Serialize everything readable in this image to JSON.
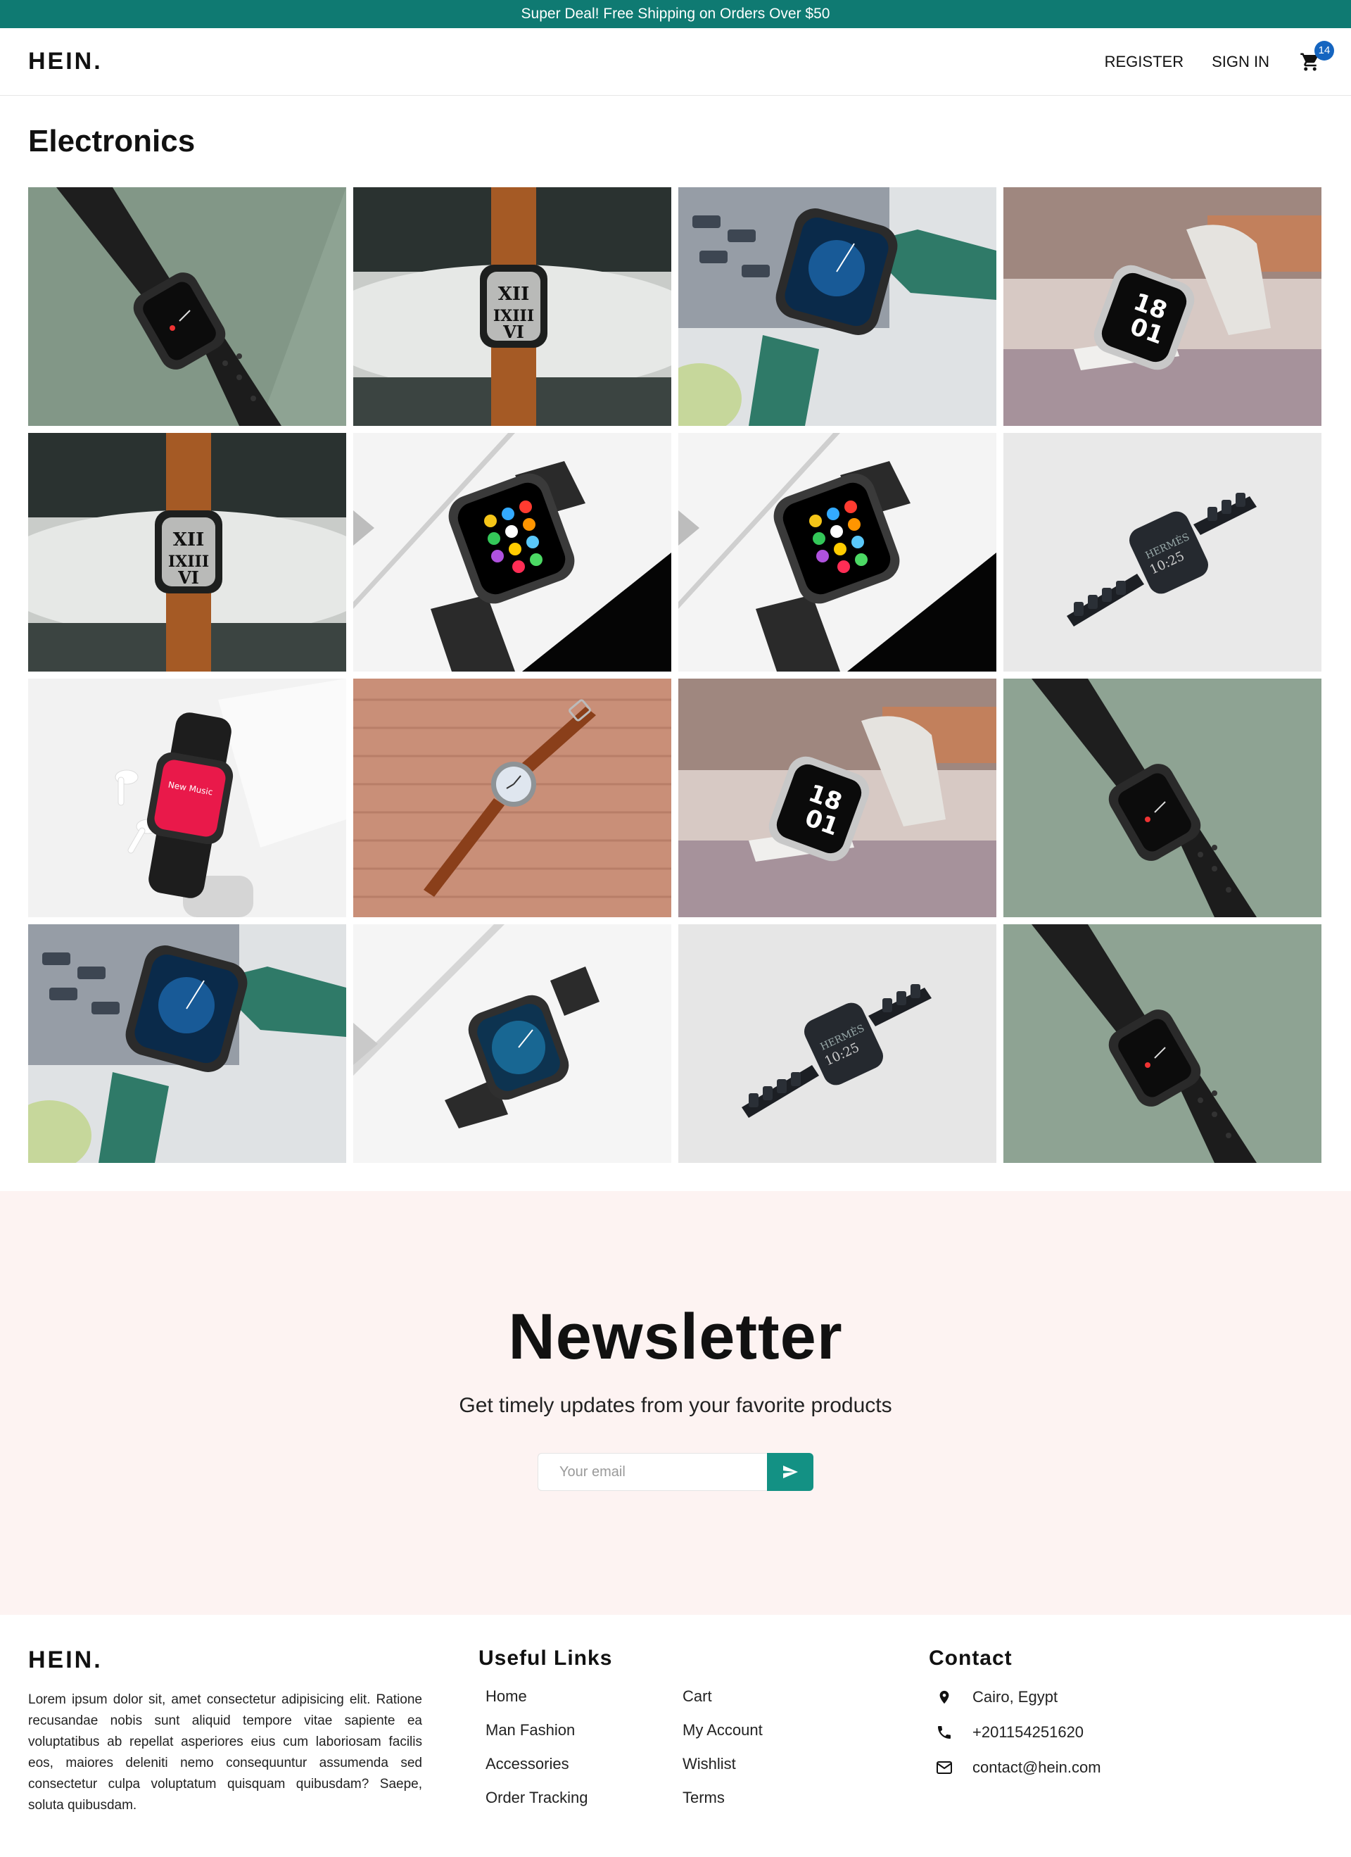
{
  "announcement": "Super Deal! Free Shipping on Orders Over $50",
  "header": {
    "logo": "HEIN.",
    "register_label": "REGISTER",
    "signin_label": "SIGN IN",
    "cart_count": "14",
    "cart_icon": "cart-icon"
  },
  "category": {
    "title": "Electronics"
  },
  "products": [
    {
      "image": "smartwatch-black-sport-band"
    },
    {
      "image": "smartwatch-orange-band-roman-dial"
    },
    {
      "image": "smartwatch-green-leather-band"
    },
    {
      "image": "smartwatch-white-band-nike-dial"
    },
    {
      "image": "smartwatch-orange-band-roman-dial"
    },
    {
      "image": "smartwatch-apps-grid-black-band"
    },
    {
      "image": "smartwatch-apps-grid-black-band"
    },
    {
      "image": "smartwatch-black-link-bracelet"
    },
    {
      "image": "smartwatch-music-with-airpods"
    },
    {
      "image": "smartwatch-brown-leather-on-wood"
    },
    {
      "image": "smartwatch-white-band-nike-dial"
    },
    {
      "image": "smartwatch-black-sport-band"
    },
    {
      "image": "smartwatch-green-leather-band"
    },
    {
      "image": "smartwatch-blue-dial-black-band"
    },
    {
      "image": "smartwatch-black-link-bracelet"
    },
    {
      "image": "smartwatch-black-sport-band"
    }
  ],
  "newsletter": {
    "title": "Newsletter",
    "subtitle": "Get timely updates from your favorite products",
    "email_placeholder": "Your email",
    "submit_icon": "send-icon"
  },
  "footer": {
    "logo": "HEIN.",
    "about": "Lorem ipsum dolor sit, amet consectetur adipisicing elit. Ratione recusandae nobis sunt aliquid tempore vitae sapiente ea voluptatibus ab repellat asperiores eius cum laboriosam facilis eos, maiores deleniti nemo consequuntur assumenda sed consectetur culpa voluptatum quisquam quibusdam? Saepe, soluta quibusdam.",
    "links_heading": "Useful Links",
    "links": [
      "Home",
      "Cart",
      "Man Fashion",
      "My Account",
      "Accessories",
      "Wishlist",
      "Order Tracking",
      "Terms"
    ],
    "contact_heading": "Contact",
    "contact": {
      "address": "Cairo, Egypt",
      "phone": "+201154251620",
      "email": "contact@hein.com"
    }
  },
  "colors": {
    "accent": "#0f7a72",
    "button": "#139184",
    "badge": "#1565c0",
    "newsletter_bg": "#fdf3f2"
  }
}
